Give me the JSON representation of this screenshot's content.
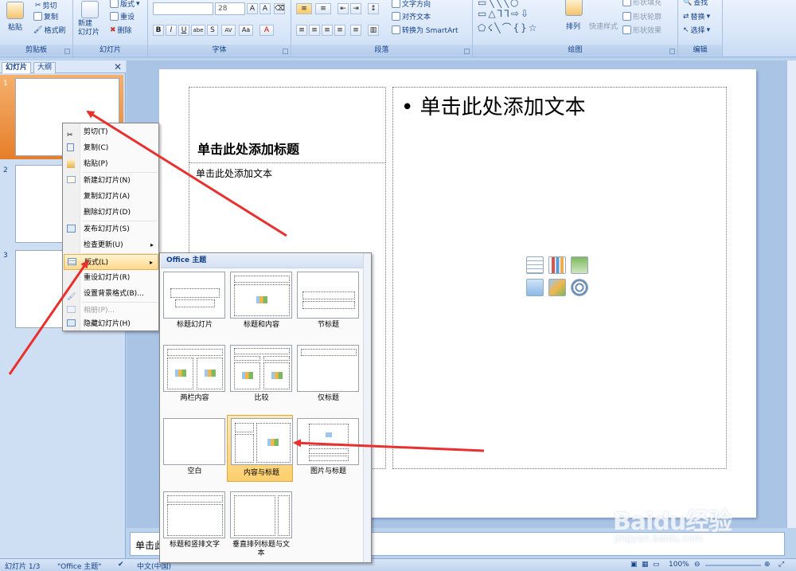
{
  "ribbon": {
    "clipboard": {
      "paste_label": "粘贴",
      "cut_label": "剪切",
      "copy_label": "复制",
      "format_painter_label": "格式刷",
      "group_label": "剪贴板"
    },
    "slides_group": {
      "new_slide_label": "新建\n幻灯片",
      "layout_label": "版式",
      "reset_label": "重设",
      "delete_label": "删除",
      "group_label": "幻灯片"
    },
    "font_group": {
      "font_size": "28",
      "group_label": "字体"
    },
    "paragraph_group": {
      "text_direction_label": "文字方向",
      "align_text_label": "对齐文本",
      "smartart_label": "转换为 SmartArt",
      "group_label": "段落"
    },
    "drawing_group": {
      "arrange_label": "排列",
      "quick_styles_label": "快速样式",
      "shape_fill_label": "形状填充",
      "shape_outline_label": "形状轮廓",
      "shape_effects_label": "形状效果",
      "group_label": "绘图"
    },
    "editing_group": {
      "find_label": "查找",
      "replace_label": "替换",
      "select_label": "选择",
      "group_label": "编辑"
    }
  },
  "left_pane": {
    "tabs": [
      "幻灯片",
      "大纲"
    ],
    "close_glyph": "✕",
    "slide_numbers": [
      "1",
      "2",
      "3"
    ]
  },
  "slide": {
    "title_placeholder": "单击此处添加标题",
    "text_placeholder": "单击此处添加文本",
    "content_placeholder": "单击此处添加文本",
    "bullet": "•"
  },
  "context_menu": {
    "items": [
      {
        "label": "剪切(T)",
        "icon": "scissors-icon"
      },
      {
        "label": "复制(C)",
        "icon": "copy-icon"
      },
      {
        "label": "粘贴(P)",
        "icon": "paste-icon"
      },
      {
        "label": "新建幻灯片(N)",
        "icon": "new-slide-icon"
      },
      {
        "label": "复制幻灯片(A)",
        "icon": ""
      },
      {
        "label": "删除幻灯片(D)",
        "icon": ""
      },
      {
        "label": "发布幻灯片(S)",
        "icon": "publish-icon"
      },
      {
        "label": "检查更新(U)",
        "icon": ""
      },
      {
        "label": "版式(L)",
        "icon": "layout-icon"
      },
      {
        "label": "重设幻灯片(R)",
        "icon": "reset-icon"
      },
      {
        "label": "设置背景格式(B)...",
        "icon": "background-icon"
      },
      {
        "label": "相册(P)...",
        "icon": "album-icon"
      },
      {
        "label": "隐藏幻灯片(H)",
        "icon": "hide-slide-icon"
      }
    ]
  },
  "layout_gallery": {
    "header": "Office 主题",
    "layouts": [
      {
        "label": "标题幻灯片"
      },
      {
        "label": "标题和内容"
      },
      {
        "label": "节标题"
      },
      {
        "label": "两栏内容"
      },
      {
        "label": "比较"
      },
      {
        "label": "仅标题"
      },
      {
        "label": "空白"
      },
      {
        "label": "内容与标题"
      },
      {
        "label": "图片与标题"
      },
      {
        "label": "标题和竖排文字"
      },
      {
        "label": "垂直排列标题与文本"
      }
    ],
    "selected_index": 7
  },
  "notes": {
    "placeholder": "单击此处添加备注"
  },
  "status_bar": {
    "slide_counter": "幻灯片 1/3",
    "theme": "\"Office 主题\"",
    "language": "中文(中国)",
    "zoom": "100%"
  },
  "watermark": {
    "logo": "Baidu经验",
    "url": "jingyan.baidu.com"
  },
  "colors": {
    "ribbon_bg": "#d8e6f8",
    "accent_orange": "#e57e2a",
    "arrow_red": "#e8302e",
    "highlight": "#ffd88c"
  }
}
